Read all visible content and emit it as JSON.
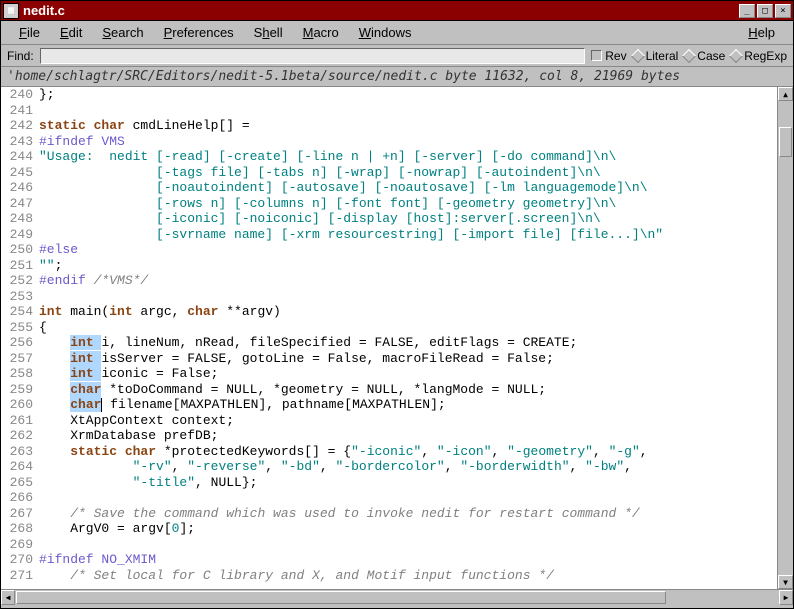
{
  "window": {
    "title": "nedit.c"
  },
  "menu": {
    "file": "File",
    "edit": "Edit",
    "search": "Search",
    "preferences": "Preferences",
    "shell": "Shell",
    "macro": "Macro",
    "windows": "Windows",
    "help": "Help"
  },
  "find": {
    "label": "Find:",
    "value": "",
    "rev": "Rev",
    "literal": "Literal",
    "case": "Case",
    "regexp": "RegExp"
  },
  "status": "'home/schlagtr/SRC/Editors/nedit-5.1beta/source/nedit.c byte 11632, col 8, 21969 bytes",
  "lines": [
    {
      "n": 240,
      "segs": [
        {
          "c": "code",
          "t": "};"
        }
      ]
    },
    {
      "n": 241,
      "segs": []
    },
    {
      "n": 242,
      "segs": [
        {
          "c": "kw",
          "t": "static char"
        },
        {
          "c": "code",
          "t": " cmdLineHelp[] ="
        }
      ]
    },
    {
      "n": 243,
      "segs": [
        {
          "c": "pp",
          "t": "#ifndef VMS"
        }
      ]
    },
    {
      "n": 244,
      "segs": [
        {
          "c": "str",
          "t": "\"Usage:  nedit [-read] [-create] [-line n | +n] [-server] [-do command]\\n\\"
        }
      ]
    },
    {
      "n": 245,
      "segs": [
        {
          "c": "str",
          "t": "               [-tags file] [-tabs n] [-wrap] [-nowrap] [-autoindent]\\n\\"
        }
      ]
    },
    {
      "n": 246,
      "segs": [
        {
          "c": "str",
          "t": "               [-noautoindent] [-autosave] [-noautosave] [-lm languagemode]\\n\\"
        }
      ]
    },
    {
      "n": 247,
      "segs": [
        {
          "c": "str",
          "t": "               [-rows n] [-columns n] [-font font] [-geometry geometry]\\n\\"
        }
      ]
    },
    {
      "n": 248,
      "segs": [
        {
          "c": "str",
          "t": "               [-iconic] [-noiconic] [-display [host]:server[.screen]\\n\\"
        }
      ]
    },
    {
      "n": 249,
      "segs": [
        {
          "c": "str",
          "t": "               [-svrname name] [-xrm resourcestring] [-import file] [file...]\\n\""
        }
      ]
    },
    {
      "n": 250,
      "segs": [
        {
          "c": "pp",
          "t": "#else"
        }
      ]
    },
    {
      "n": 251,
      "segs": [
        {
          "c": "str",
          "t": "\"\""
        },
        {
          "c": "code",
          "t": ";"
        }
      ]
    },
    {
      "n": 252,
      "segs": [
        {
          "c": "pp",
          "t": "#endif "
        },
        {
          "c": "cmt",
          "t": "/*VMS*/"
        }
      ]
    },
    {
      "n": 253,
      "segs": []
    },
    {
      "n": 254,
      "segs": [
        {
          "c": "kw",
          "t": "int"
        },
        {
          "c": "code",
          "t": " main("
        },
        {
          "c": "kw",
          "t": "int"
        },
        {
          "c": "code",
          "t": " argc, "
        },
        {
          "c": "kw",
          "t": "char"
        },
        {
          "c": "code",
          "t": " **argv)"
        }
      ]
    },
    {
      "n": 255,
      "segs": [
        {
          "c": "code",
          "t": "{"
        }
      ]
    },
    {
      "n": 256,
      "segs": [
        {
          "c": "code",
          "t": "    "
        },
        {
          "c": "kw-sel",
          "t": "int "
        },
        {
          "c": "code",
          "t": "i, lineNum, nRead, fileSpecified = FALSE, editFlags = CREATE;"
        }
      ]
    },
    {
      "n": 257,
      "segs": [
        {
          "c": "code",
          "t": "    "
        },
        {
          "c": "kw-sel",
          "t": "int "
        },
        {
          "c": "code",
          "t": "isServer = FALSE, gotoLine = False, macroFileRead = False;"
        }
      ]
    },
    {
      "n": 258,
      "segs": [
        {
          "c": "code",
          "t": "    "
        },
        {
          "c": "kw-sel",
          "t": "int "
        },
        {
          "c": "code",
          "t": "iconic = False;"
        }
      ]
    },
    {
      "n": 259,
      "segs": [
        {
          "c": "code",
          "t": "    "
        },
        {
          "c": "kw-sel",
          "t": "char"
        },
        {
          "c": "code",
          "t": " *toDoCommand = NULL, *geometry = NULL, *langMode = NULL;"
        }
      ]
    },
    {
      "n": 260,
      "segs": [
        {
          "c": "code",
          "t": "    "
        },
        {
          "c": "kw-sel",
          "t": "char"
        },
        {
          "c": "caret",
          "t": ""
        },
        {
          "c": "code",
          "t": " filename[MAXPATHLEN], pathname[MAXPATHLEN];"
        }
      ]
    },
    {
      "n": 261,
      "segs": [
        {
          "c": "code",
          "t": "    XtAppContext context;"
        }
      ]
    },
    {
      "n": 262,
      "segs": [
        {
          "c": "code",
          "t": "    XrmDatabase prefDB;"
        }
      ]
    },
    {
      "n": 263,
      "segs": [
        {
          "c": "code",
          "t": "    "
        },
        {
          "c": "kw",
          "t": "static char"
        },
        {
          "c": "code",
          "t": " *protectedKeywords[] = {"
        },
        {
          "c": "str",
          "t": "\"-iconic\""
        },
        {
          "c": "code",
          "t": ", "
        },
        {
          "c": "str",
          "t": "\"-icon\""
        },
        {
          "c": "code",
          "t": ", "
        },
        {
          "c": "str",
          "t": "\"-geometry\""
        },
        {
          "c": "code",
          "t": ", "
        },
        {
          "c": "str",
          "t": "\"-g\""
        },
        {
          "c": "code",
          "t": ","
        }
      ]
    },
    {
      "n": 264,
      "segs": [
        {
          "c": "code",
          "t": "            "
        },
        {
          "c": "str",
          "t": "\"-rv\""
        },
        {
          "c": "code",
          "t": ", "
        },
        {
          "c": "str",
          "t": "\"-reverse\""
        },
        {
          "c": "code",
          "t": ", "
        },
        {
          "c": "str",
          "t": "\"-bd\""
        },
        {
          "c": "code",
          "t": ", "
        },
        {
          "c": "str",
          "t": "\"-bordercolor\""
        },
        {
          "c": "code",
          "t": ", "
        },
        {
          "c": "str",
          "t": "\"-borderwidth\""
        },
        {
          "c": "code",
          "t": ", "
        },
        {
          "c": "str",
          "t": "\"-bw\""
        },
        {
          "c": "code",
          "t": ","
        }
      ]
    },
    {
      "n": 265,
      "segs": [
        {
          "c": "code",
          "t": "            "
        },
        {
          "c": "str",
          "t": "\"-title\""
        },
        {
          "c": "code",
          "t": ", NULL};"
        }
      ]
    },
    {
      "n": 266,
      "segs": []
    },
    {
      "n": 267,
      "segs": [
        {
          "c": "code",
          "t": "    "
        },
        {
          "c": "cmt",
          "t": "/* Save the command which was used to invoke nedit for restart command */"
        }
      ]
    },
    {
      "n": 268,
      "segs": [
        {
          "c": "code",
          "t": "    ArgV0 = argv["
        },
        {
          "c": "num",
          "t": "0"
        },
        {
          "c": "code",
          "t": "];"
        }
      ]
    },
    {
      "n": 269,
      "segs": []
    },
    {
      "n": 270,
      "segs": [
        {
          "c": "pp",
          "t": "#ifndef NO_XMIM"
        }
      ]
    },
    {
      "n": 271,
      "segs": [
        {
          "c": "code",
          "t": "    "
        },
        {
          "c": "cmt",
          "t": "/* Set local for C library and X, and Motif input functions */"
        }
      ]
    }
  ]
}
